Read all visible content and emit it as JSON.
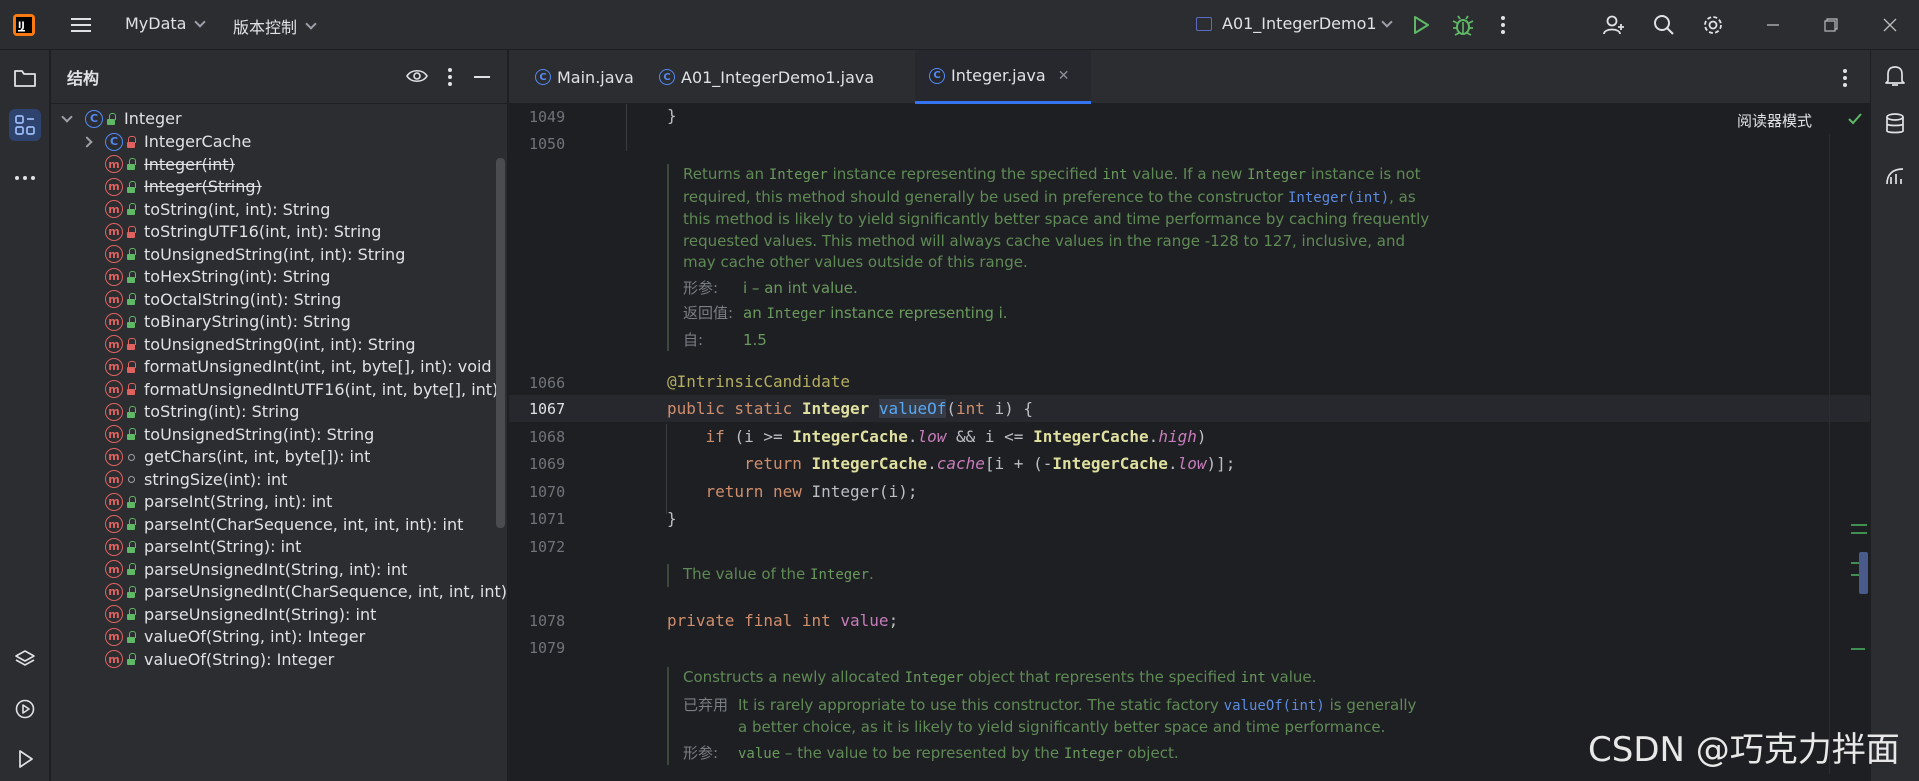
{
  "titlebar": {
    "project": "MyData",
    "vcs": "版本控制",
    "run_config": "A01_IntegerDemo1"
  },
  "structure": {
    "title": "结构",
    "root": "Integer",
    "items": [
      {
        "label": "IntegerCache",
        "kind": "class",
        "vis": "priv",
        "expandable": true
      },
      {
        "label": "Integer(int)",
        "kind": "method",
        "vis": "pub",
        "deprecated": true
      },
      {
        "label": "Integer(String)",
        "kind": "method",
        "vis": "pub",
        "deprecated": true
      },
      {
        "label": "toString(int, int): String",
        "kind": "method",
        "vis": "pub"
      },
      {
        "label": "toStringUTF16(int, int): String",
        "kind": "method",
        "vis": "priv"
      },
      {
        "label": "toUnsignedString(int, int): String",
        "kind": "method",
        "vis": "pub"
      },
      {
        "label": "toHexString(int): String",
        "kind": "method",
        "vis": "pub"
      },
      {
        "label": "toOctalString(int): String",
        "kind": "method",
        "vis": "pub"
      },
      {
        "label": "toBinaryString(int): String",
        "kind": "method",
        "vis": "pub"
      },
      {
        "label": "toUnsignedString0(int, int): String",
        "kind": "method",
        "vis": "priv"
      },
      {
        "label": "formatUnsignedInt(int, int, byte[], int): void",
        "kind": "method",
        "vis": "priv"
      },
      {
        "label": "formatUnsignedIntUTF16(int, int, byte[], int):",
        "kind": "method",
        "vis": "priv"
      },
      {
        "label": "toString(int): String",
        "kind": "method",
        "vis": "pub"
      },
      {
        "label": "toUnsignedString(int): String",
        "kind": "method",
        "vis": "pub"
      },
      {
        "label": "getChars(int, int, byte[]): int",
        "kind": "method",
        "vis": "pkg"
      },
      {
        "label": "stringSize(int): int",
        "kind": "method",
        "vis": "pkg"
      },
      {
        "label": "parseInt(String, int): int",
        "kind": "method",
        "vis": "pub"
      },
      {
        "label": "parseInt(CharSequence, int, int, int): int",
        "kind": "method",
        "vis": "pub"
      },
      {
        "label": "parseInt(String): int",
        "kind": "method",
        "vis": "pub"
      },
      {
        "label": "parseUnsignedInt(String, int): int",
        "kind": "method",
        "vis": "pub"
      },
      {
        "label": "parseUnsignedInt(CharSequence, int, int, int):",
        "kind": "method",
        "vis": "pub"
      },
      {
        "label": "parseUnsignedInt(String): int",
        "kind": "method",
        "vis": "pub"
      },
      {
        "label": "valueOf(String, int): Integer",
        "kind": "method",
        "vis": "pub"
      },
      {
        "label": "valueOf(String): Integer",
        "kind": "method",
        "vis": "pub"
      }
    ]
  },
  "tabs": [
    {
      "label": "Main.java"
    },
    {
      "label": "A01_IntegerDemo1.java"
    },
    {
      "label": "Integer.java",
      "active": true
    }
  ],
  "editor": {
    "reader_mode": "阅读器模式",
    "lines": {
      "l1049": "1049",
      "l1050": "1050",
      "l1066": "1066",
      "l1067": "1067",
      "l1068": "1068",
      "l1069": "1069",
      "l1070": "1070",
      "l1071": "1071",
      "l1072": "1072",
      "l1078": "1078",
      "l1079": "1079"
    },
    "doc1": {
      "p1": "Returns an ",
      "p1m": "Integer",
      "p2": " instance representing the specified ",
      "p2m": "int",
      "p3": " value. If a new ",
      "p3m": "Integer",
      "p4": " instance is not",
      "line2a": "required, this method should generally be used in preference to the constructor ",
      "line2link": "Integer(int)",
      "line2b": ", as",
      "line3": "this method is likely to yield significantly better space and time performance by caching frequently",
      "line4": "requested values. This method will always cache values in the range -128 to 127, inclusive, and",
      "line5": "may cache other values outside of this range.",
      "param_tag": "形参:",
      "param_val": "i – an int value.",
      "return_tag": "返回值:",
      "return_a": "an ",
      "return_m": "Integer",
      "return_b": " instance representing i.",
      "since_tag": "自:",
      "since_val": "1.5"
    },
    "doc2": {
      "a": "The value of the ",
      "m": "Integer",
      "b": "."
    },
    "doc3": {
      "a": "Constructs a newly allocated ",
      "m1": "Integer",
      "b": " object that represents the specified ",
      "m2": "int",
      "c": " value.",
      "dep_tag": "已弃用",
      "dep_a": "It is rarely appropriate to use this constructor. The static factory ",
      "dep_link": "valueOf(int)",
      "dep_b": " is generally",
      "dep_line2": "a better choice, as it is likely to yield significantly better space and time performance.",
      "param_tag": "形参:",
      "param_m": "value",
      "param_a": " – the value to be represented by the ",
      "param_m2": "Integer",
      "param_b": " object."
    }
  },
  "watermark": "CSDN @巧克力拌面"
}
